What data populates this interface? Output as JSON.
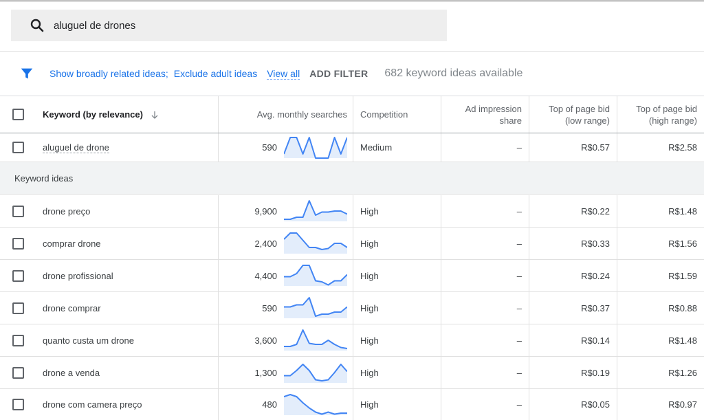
{
  "search": {
    "query": "aluguel de drones"
  },
  "filters": {
    "link_broad": "Show broadly related ideas;",
    "link_adult": "Exclude adult ideas",
    "view_all": "View all",
    "add_filter": "ADD FILTER",
    "available": "682 keyword ideas available"
  },
  "table": {
    "headers": {
      "keyword": "Keyword (by relevance)",
      "avg_line1": "Avg. monthly searches",
      "competition": "Competition",
      "impression_line1": "Ad impression",
      "impression_line2": "share",
      "low_line1": "Top of page bid",
      "low_line2": "(low range)",
      "high_line1": "Top of page bid",
      "high_line2": "(high range)"
    },
    "exact": {
      "keyword": "aluguel de drone",
      "avg": "590",
      "trend": [
        0.2,
        1,
        1,
        0.2,
        1,
        0,
        0,
        0,
        1,
        0.2,
        1
      ],
      "competition": "Medium",
      "impression": "–",
      "low": "R$0.57",
      "high": "R$2.58"
    },
    "section_label": "Keyword ideas",
    "rows": [
      {
        "keyword": "drone preço",
        "avg": "9,900",
        "trend": [
          0.1,
          0.1,
          0.2,
          0.2,
          1,
          0.3,
          0.45,
          0.45,
          0.5,
          0.5,
          0.35
        ],
        "competition": "High",
        "impression": "–",
        "low": "R$0.22",
        "high": "R$1.48"
      },
      {
        "keyword": "comprar drone",
        "avg": "2,400",
        "trend": [
          0.7,
          1,
          1,
          0.65,
          0.3,
          0.3,
          0.2,
          0.25,
          0.5,
          0.5,
          0.3
        ],
        "competition": "High",
        "impression": "–",
        "low": "R$0.33",
        "high": "R$1.56"
      },
      {
        "keyword": "drone profissional",
        "avg": "4,400",
        "trend": [
          0.45,
          0.45,
          0.6,
          1,
          1,
          0.25,
          0.2,
          0.05,
          0.25,
          0.25,
          0.55
        ],
        "competition": "High",
        "impression": "–",
        "low": "R$0.24",
        "high": "R$1.59"
      },
      {
        "keyword": "drone comprar",
        "avg": "590",
        "trend": [
          0.55,
          0.55,
          0.65,
          0.65,
          1,
          0.1,
          0.2,
          0.2,
          0.3,
          0.3,
          0.55
        ],
        "competition": "High",
        "impression": "–",
        "low": "R$0.37",
        "high": "R$0.88"
      },
      {
        "keyword": "quanto custa um drone",
        "avg": "3,600",
        "trend": [
          0.2,
          0.2,
          0.3,
          1,
          0.35,
          0.3,
          0.3,
          0.5,
          0.3,
          0.15,
          0.1
        ],
        "competition": "High",
        "impression": "–",
        "low": "R$0.14",
        "high": "R$1.48"
      },
      {
        "keyword": "drone a venda",
        "avg": "1,300",
        "trend": [
          0.35,
          0.35,
          0.6,
          0.9,
          0.6,
          0.15,
          0.1,
          0.15,
          0.5,
          0.9,
          0.55
        ],
        "competition": "High",
        "impression": "–",
        "low": "R$0.19",
        "high": "R$1.26"
      },
      {
        "keyword": "drone com camera preço",
        "avg": "480",
        "trend": [
          0.9,
          1,
          0.9,
          0.6,
          0.35,
          0.15,
          0.05,
          0.15,
          0.05,
          0.1,
          0.1
        ],
        "competition": "High",
        "impression": "–",
        "low": "R$0.05",
        "high": "R$0.97"
      }
    ]
  },
  "colors": {
    "link": "#1a73e8",
    "spark_line": "#4285f4",
    "spark_fill": "#e3edfb"
  }
}
